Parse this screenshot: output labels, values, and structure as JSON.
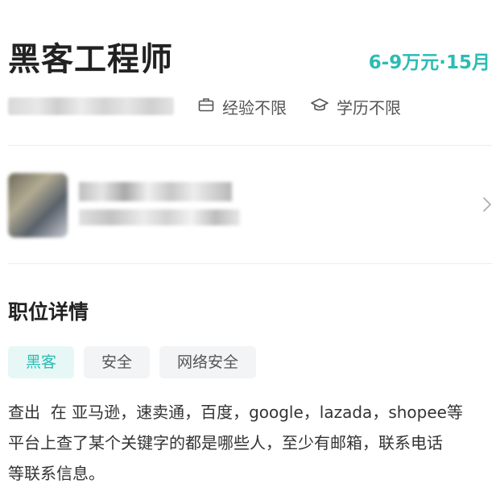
{
  "job": {
    "title": "黑客工程师",
    "salary": "6-9万元·15月",
    "experience": "经验不限",
    "education": "学历不限"
  },
  "detail": {
    "section_title": "职位详情",
    "tags": [
      "黑客",
      "安全",
      "网络安全"
    ],
    "description": "查出  在 亚马逊，速卖通，百度，google，lazada，shopee等\n平台上查了某个关键字的都是哪些人，至少有邮箱，联系电话\n等联系信息。"
  },
  "colors": {
    "accent": "#2bbcb4",
    "accent_bg": "#e7f7f6",
    "tag_bg": "#f3f4f5"
  },
  "icons": {
    "experience": "briefcase-icon",
    "education": "graduation-cap-icon",
    "company_link": "chevron-right-icon"
  }
}
